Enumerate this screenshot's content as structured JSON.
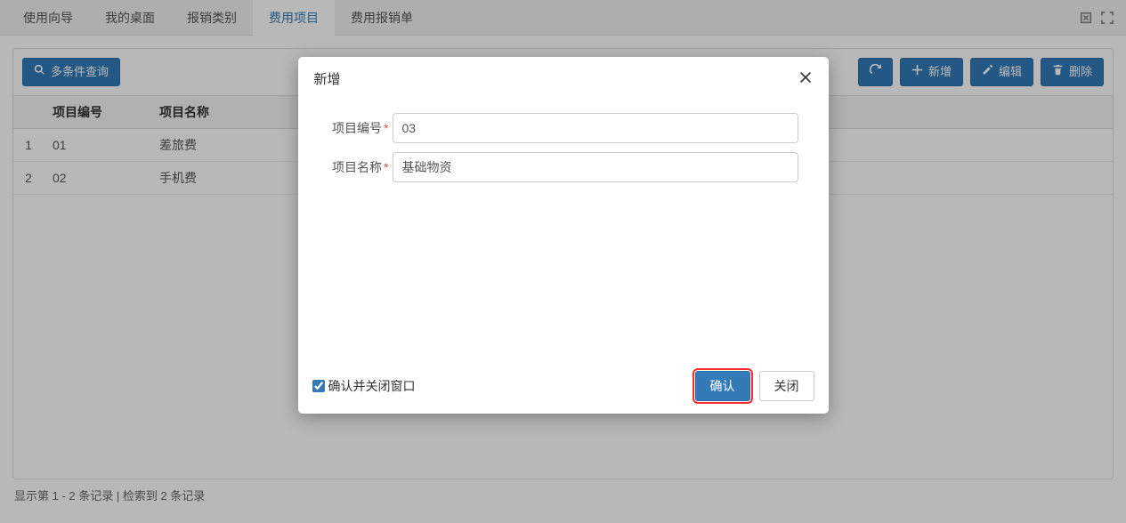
{
  "tabs": {
    "items": [
      {
        "label": "使用向导",
        "active": false
      },
      {
        "label": "我的桌面",
        "active": false
      },
      {
        "label": "报销类别",
        "active": false
      },
      {
        "label": "费用项目",
        "active": true
      },
      {
        "label": "费用报销单",
        "active": false
      }
    ]
  },
  "toolbar": {
    "search_label": "多条件查询",
    "add_label": "新增",
    "edit_label": "编辑",
    "delete_label": "删除"
  },
  "table": {
    "headers": {
      "code": "项目编号",
      "name": "项目名称"
    },
    "rows": [
      {
        "idx": "1",
        "code": "01",
        "name": "差旅费"
      },
      {
        "idx": "2",
        "code": "02",
        "name": "手机费"
      }
    ]
  },
  "footer": {
    "text": "显示第 1 - 2 条记录 | 检索到 2 条记录"
  },
  "modal": {
    "title": "新增",
    "fields": {
      "code": {
        "label": "项目编号",
        "value": "03"
      },
      "name": {
        "label": "项目名称",
        "value": "基础物资"
      }
    },
    "confirm_close_label": "确认并关闭窗口",
    "confirm_close_checked": true,
    "confirm_label": "确认",
    "close_label": "关闭"
  }
}
